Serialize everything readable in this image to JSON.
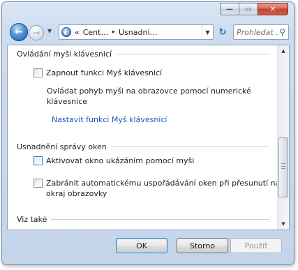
{
  "window": {
    "caption": {
      "min_glyph": "—",
      "max_glyph": "▭",
      "close_glyph": "✕"
    }
  },
  "nav": {
    "back_glyph": "←",
    "fwd_glyph": "→",
    "address": {
      "prefix": "«",
      "segments": [
        "Cent…",
        "Usnadni…"
      ],
      "separator": "▸"
    },
    "refresh_glyph": "↻",
    "search_placeholder": "Prohledat …",
    "search_glyph": "⚲"
  },
  "sections": {
    "mouse_keys": {
      "title": "Ovládání myši klávesnicí",
      "checkbox_label": "Zapnout funkci Myš klávesnicí",
      "checked": false,
      "description": "Ovládat pohyb myši na obrazovce pomocí numerické klávesnice",
      "link": "Nastavit funkci Myš klávesnicí"
    },
    "window_mgmt": {
      "title": "Usnadnění správy oken",
      "option1_label": "Aktivovat okno ukázáním pomocí myši",
      "option1_checked": false,
      "option2_line1": "Zabránit automatickému uspořádávání oken při přesunutí na",
      "option2_line2": "okraj obrazovky",
      "option2_checked": false
    },
    "see_also": {
      "title": "Viz také"
    }
  },
  "footer": {
    "ok_label": "OK",
    "cancel_label": "Storno",
    "apply_label": "Použít"
  }
}
